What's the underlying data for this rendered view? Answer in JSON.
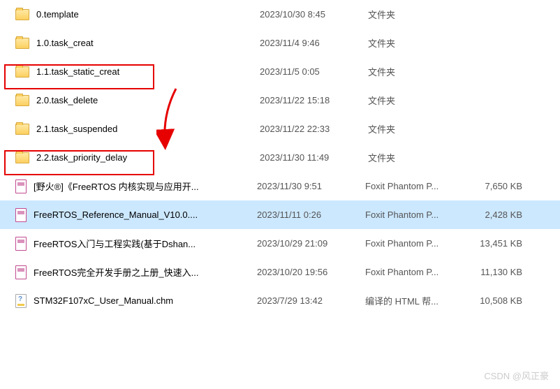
{
  "files": [
    {
      "name": "0.template",
      "date": "2023/10/30 8:45",
      "type": "文件夹",
      "size": "",
      "icon": "folder"
    },
    {
      "name": "1.0.task_creat",
      "date": "2023/11/4 9:46",
      "type": "文件夹",
      "size": "",
      "icon": "folder"
    },
    {
      "name": "1.1.task_static_creat",
      "date": "2023/11/5 0:05",
      "type": "文件夹",
      "size": "",
      "icon": "folder"
    },
    {
      "name": "2.0.task_delete",
      "date": "2023/11/22 15:18",
      "type": "文件夹",
      "size": "",
      "icon": "folder"
    },
    {
      "name": "2.1.task_suspended",
      "date": "2023/11/22 22:33",
      "type": "文件夹",
      "size": "",
      "icon": "folder"
    },
    {
      "name": "2.2.task_priority_delay",
      "date": "2023/11/30 11:49",
      "type": "文件夹",
      "size": "",
      "icon": "folder"
    },
    {
      "name": "[野火®]《FreeRTOS 内核实现与应用开...",
      "date": "2023/11/30 9:51",
      "type": "Foxit Phantom P...",
      "size": "7,650 KB",
      "icon": "pdf"
    },
    {
      "name": "FreeRTOS_Reference_Manual_V10.0....",
      "date": "2023/11/11 0:26",
      "type": "Foxit Phantom P...",
      "size": "2,428 KB",
      "icon": "pdf"
    },
    {
      "name": "FreeRTOS入门与工程实践(基于Dshan...",
      "date": "2023/10/29 21:09",
      "type": "Foxit Phantom P...",
      "size": "13,451 KB",
      "icon": "pdf"
    },
    {
      "name": "FreeRTOS完全开发手册之上册_快速入...",
      "date": "2023/10/20 19:56",
      "type": "Foxit Phantom P...",
      "size": "11,130 KB",
      "icon": "pdf"
    },
    {
      "name": "STM32F107xC_User_Manual.chm",
      "date": "2023/7/29 13:42",
      "type": "编译的 HTML 帮...",
      "size": "10,508 KB",
      "icon": "chm"
    }
  ],
  "annotations": {
    "highlight_indices": [
      2,
      5
    ],
    "selected_index": 7
  },
  "watermark": "CSDN @风正豪"
}
